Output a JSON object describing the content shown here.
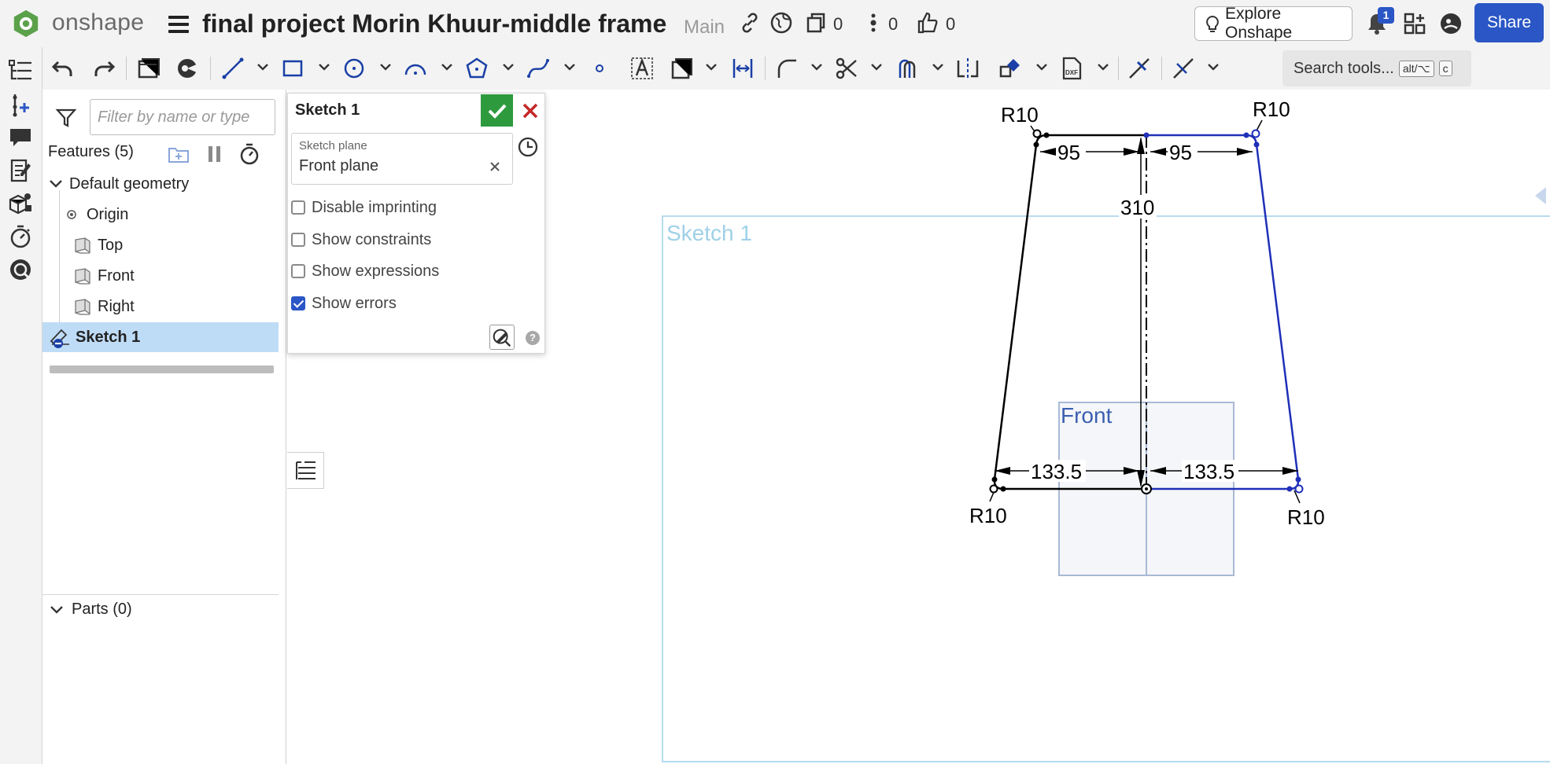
{
  "app": {
    "brand": "onshape",
    "document_title": "final project Morin Khuur-middle frame",
    "branch": "Main",
    "counts": {
      "versions": "0",
      "details": "0",
      "likes": "0"
    },
    "explore_label": "Explore Onshape",
    "notifications_count": "1",
    "share_label": "Share",
    "accent_color": "#2a56c6"
  },
  "toolbar": {
    "search_label": "Search tools...",
    "search_shortcut_1": "alt/⌥",
    "search_shortcut_2": "c"
  },
  "feature_panel": {
    "filter_placeholder": "Filter by name or type",
    "features_header": "Features (5)",
    "tree": [
      {
        "label": "Default geometry"
      },
      {
        "label": "Origin"
      },
      {
        "label": "Top"
      },
      {
        "label": "Front"
      },
      {
        "label": "Right"
      },
      {
        "label": "Sketch 1"
      }
    ],
    "parts_header": "Parts (0)"
  },
  "sketch_dialog": {
    "title": "Sketch 1",
    "plane_label": "Sketch plane",
    "plane_value": "Front plane",
    "options": [
      {
        "label": "Disable imprinting",
        "checked": false
      },
      {
        "label": "Show constraints",
        "checked": false
      },
      {
        "label": "Show expressions",
        "checked": false
      },
      {
        "label": "Show errors",
        "checked": true
      }
    ]
  },
  "viewport": {
    "sketch_label": "Sketch 1",
    "plane_label": "Front",
    "dimensions": {
      "top_left_half": "95",
      "top_right_half": "95",
      "height": "310",
      "bottom_left_half": "133.5",
      "bottom_right_half": "133.5",
      "fillet_top_left": "R10",
      "fillet_top_right": "R10",
      "fillet_bottom_left": "R10",
      "fillet_bottom_right": "R10"
    },
    "colors": {
      "constrained": "#000000",
      "underconstrained": "#1f2fb8",
      "sketch_frame": "#9fd0e8",
      "plane": "#dfe6ef"
    }
  }
}
